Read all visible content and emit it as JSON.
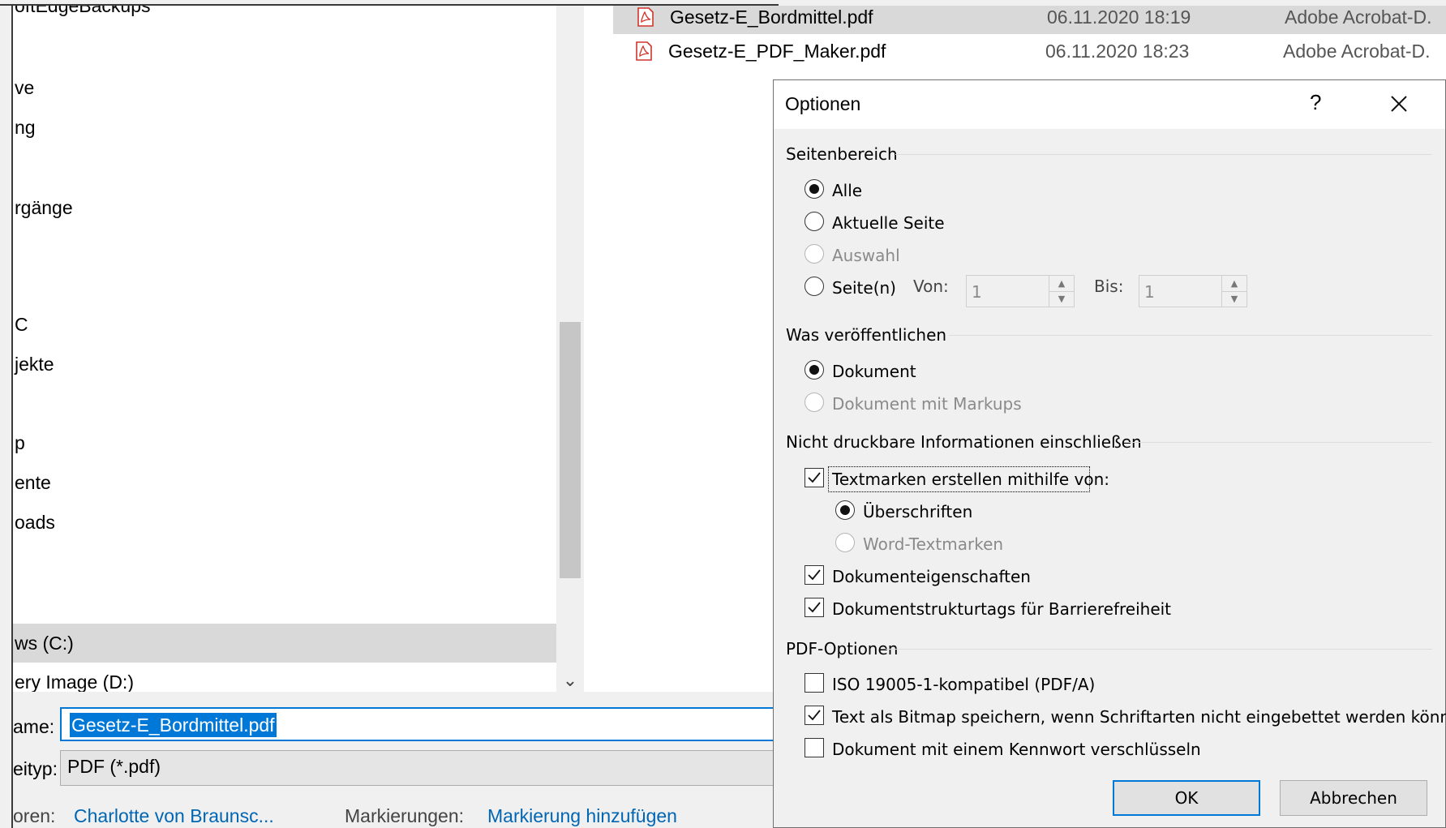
{
  "nav": {
    "items": [
      {
        "label": "oftEdgeBackups"
      },
      {
        "label": "ve"
      },
      {
        "label": "ng"
      },
      {
        "label": "rgänge"
      },
      {
        "label": "C"
      },
      {
        "label": "jekte"
      },
      {
        "label": "p"
      },
      {
        "label": "ente"
      },
      {
        "label": "oads"
      },
      {
        "label": "ws  (C:)"
      },
      {
        "label": "ery Image (D:)"
      }
    ],
    "scroll_down_glyph": "⌄"
  },
  "files": [
    {
      "name": "Gesetz-E_Bordmittel.pdf",
      "date": "06.11.2020 18:19",
      "type": "Adobe Acrobat-D."
    },
    {
      "name": "Gesetz-E_PDF_Maker.pdf",
      "date": "06.11.2020 18:23",
      "type": "Adobe Acrobat-D."
    }
  ],
  "form": {
    "filename_label": "ame:",
    "filename_value": "Gesetz-E_Bordmittel.pdf",
    "filetype_label": "eityp:",
    "filetype_value": "PDF (*.pdf)",
    "authors_label": "oren:",
    "authors_value": "Charlotte von Braunsc...",
    "tags_label": "Markierungen:",
    "tags_value": "Markierung hinzufügen"
  },
  "options": {
    "title": "Optionen",
    "help_glyph": "?",
    "page_range": {
      "label": "Seitenbereich",
      "all": "Alle",
      "current": "Aktuelle Seite",
      "selection": "Auswahl",
      "pages": "Seite(n)",
      "from_label": "Von:",
      "from_value": "1",
      "to_label": "Bis:",
      "to_value": "1",
      "selected": "all"
    },
    "publish": {
      "label": "Was veröffentlichen",
      "document": "Dokument",
      "document_markups": "Dokument mit Markups",
      "selected": "document"
    },
    "nonprint": {
      "label": "Nicht druckbare Informationen einschließen",
      "bookmarks": "Textmarken erstellen mithilfe von:",
      "bookmarks_checked": true,
      "headings": "Überschriften",
      "word_bookmarks": "Word-Textmarken",
      "props": "Dokumenteigenschaften",
      "props_checked": true,
      "tags": "Dokumentstrukturtags für Barrierefreiheit",
      "tags_checked": true
    },
    "pdf": {
      "label": "PDF-Optionen",
      "iso": "ISO 19005-1-kompatibel (PDF/A)",
      "iso_checked": false,
      "bitmap": "Text als Bitmap speichern, wenn Schriftarten nicht eingebettet werden können",
      "bitmap_checked": true,
      "encrypt": "Dokument mit einem Kennwort verschlüsseln",
      "encrypt_checked": false
    },
    "ok": "OK",
    "cancel": "Abbrechen"
  }
}
